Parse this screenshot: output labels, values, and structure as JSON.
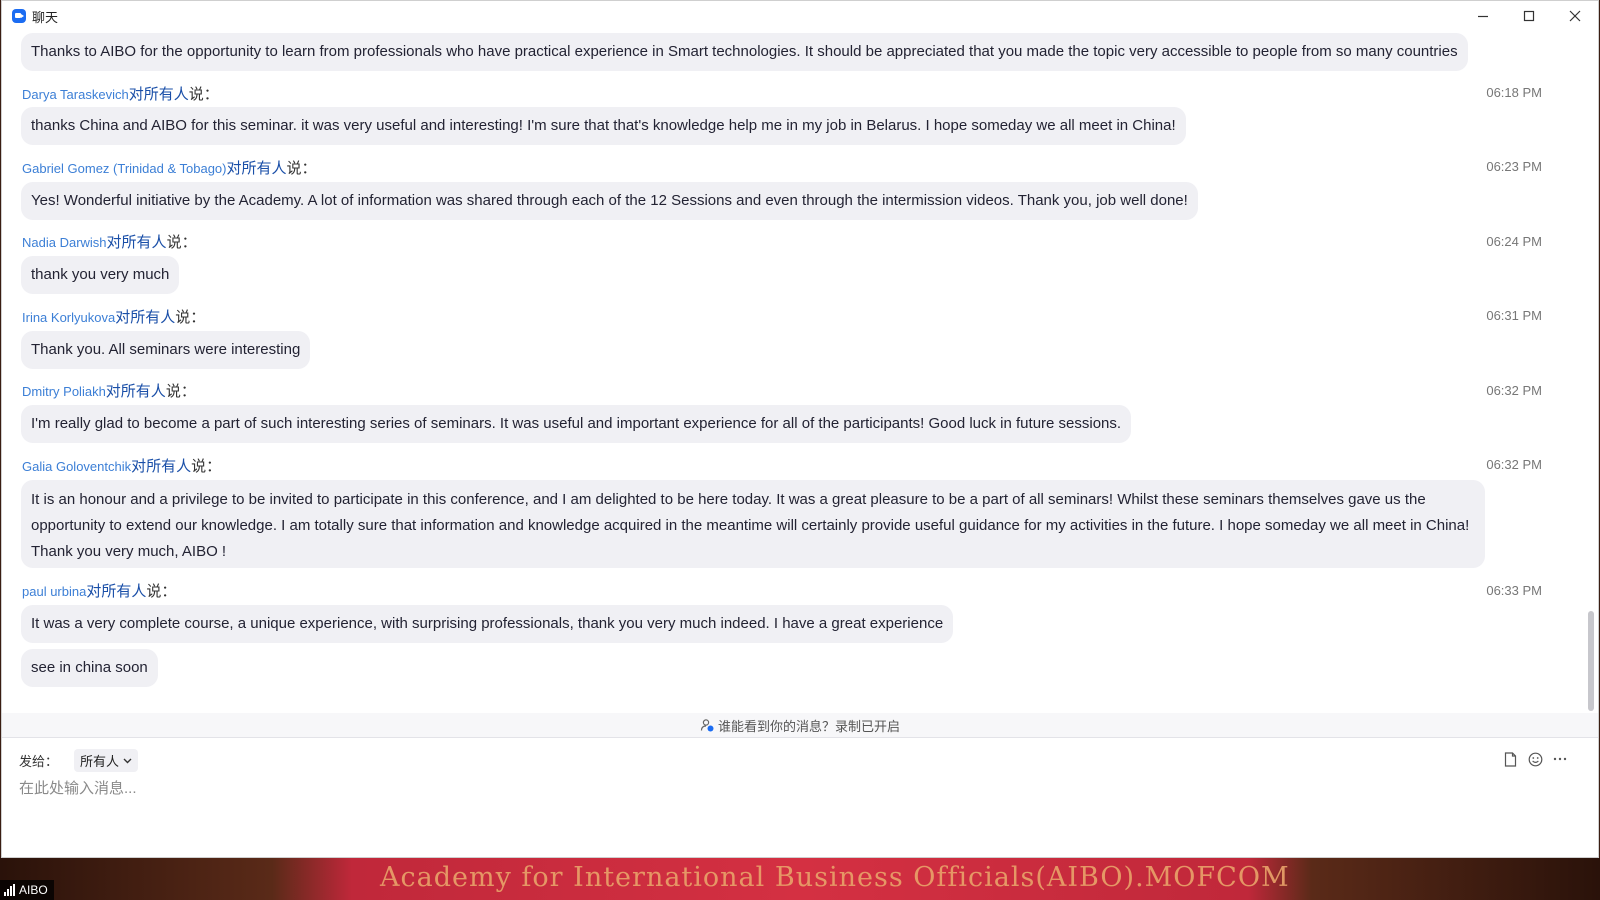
{
  "window": {
    "title": "聊天"
  },
  "top_bubble": "Thanks to AIBO for the opportunity to learn from professionals who have practical experience in Smart technologies. It should be appreciated that you made the topic very accessible to people from so many countries",
  "messages": [
    {
      "sender": "Darya Taraskevich",
      "to": "对所有人",
      "say": "说：",
      "time": "06:18 PM",
      "texts": [
        "thanks China and AIBO for this seminar. it was very useful and interesting! I'm sure that that's knowledge help me in my job in Belarus. I hope someday we all meet in China!"
      ]
    },
    {
      "sender": "Gabriel Gomez (Trinidad & Tobago)",
      "to": "对所有人",
      "say": "说：",
      "time": "06:23 PM",
      "texts": [
        "Yes! Wonderful initiative by the Academy. A lot of information was shared through each of the 12 Sessions and even through the intermission videos. Thank you, job well done!"
      ]
    },
    {
      "sender": "Nadia Darwish",
      "to": "对所有人",
      "say": "说：",
      "time": "06:24 PM",
      "texts": [
        "thank you very much"
      ]
    },
    {
      "sender": "Irina Korlyukova",
      "to": "对所有人",
      "say": "说：",
      "time": "06:31 PM",
      "texts": [
        "Thank you. All seminars were interesting"
      ]
    },
    {
      "sender": "Dmitry Poliakh",
      "to": "对所有人",
      "say": "说：",
      "time": "06:32 PM",
      "texts": [
        "I'm really glad to become a part of such interesting series of seminars. It was useful and important experience for all of the participants! Good luck in future sessions."
      ]
    },
    {
      "sender": "Galia Goloventchik",
      "to": "对所有人",
      "say": "说：",
      "time": "06:32 PM",
      "texts": [
        "It is an honour and a privilege to be invited to participate in this conference, and I am delighted to be here today. It was a great pleasure to be a part of all seminars! Whilst these seminars themselves gave us the opportunity to extend our knowledge. I am totally sure that information and knowledge acquired in the meantime will certainly provide useful guidance for my activities in the future. I hope someday we all meet in China!      Thank you very much, AIBO !"
      ]
    },
    {
      "sender": "paul urbina",
      "to": "对所有人",
      "say": "说：",
      "time": "06:33 PM",
      "texts": [
        "It was a very complete course, a unique experience, with surprising professionals, thank you very much indeed.  I have a great experience",
        "see in china soon"
      ]
    }
  ],
  "privacy_notice": "谁能看到你的消息？录制已开启",
  "send_to_label": "发给：",
  "recipient": "所有人",
  "input_placeholder": "在此处输入消息...",
  "video_label": "AIBO",
  "background_banner": "Academy for International Business Officials(AIBO).MOFCOM",
  "icons": {
    "app": "zoom-chat-icon",
    "minimize": "minimize-icon",
    "maximize": "maximize-icon",
    "close": "close-icon",
    "privacy": "user-shield-icon",
    "file": "file-icon",
    "emoji": "emoji-icon",
    "more": "more-icon",
    "signal": "signal-icon"
  },
  "colors": {
    "sender": "#3c7fd6",
    "bubble": "#f0f0f4",
    "accent": "#1b6cf2"
  }
}
